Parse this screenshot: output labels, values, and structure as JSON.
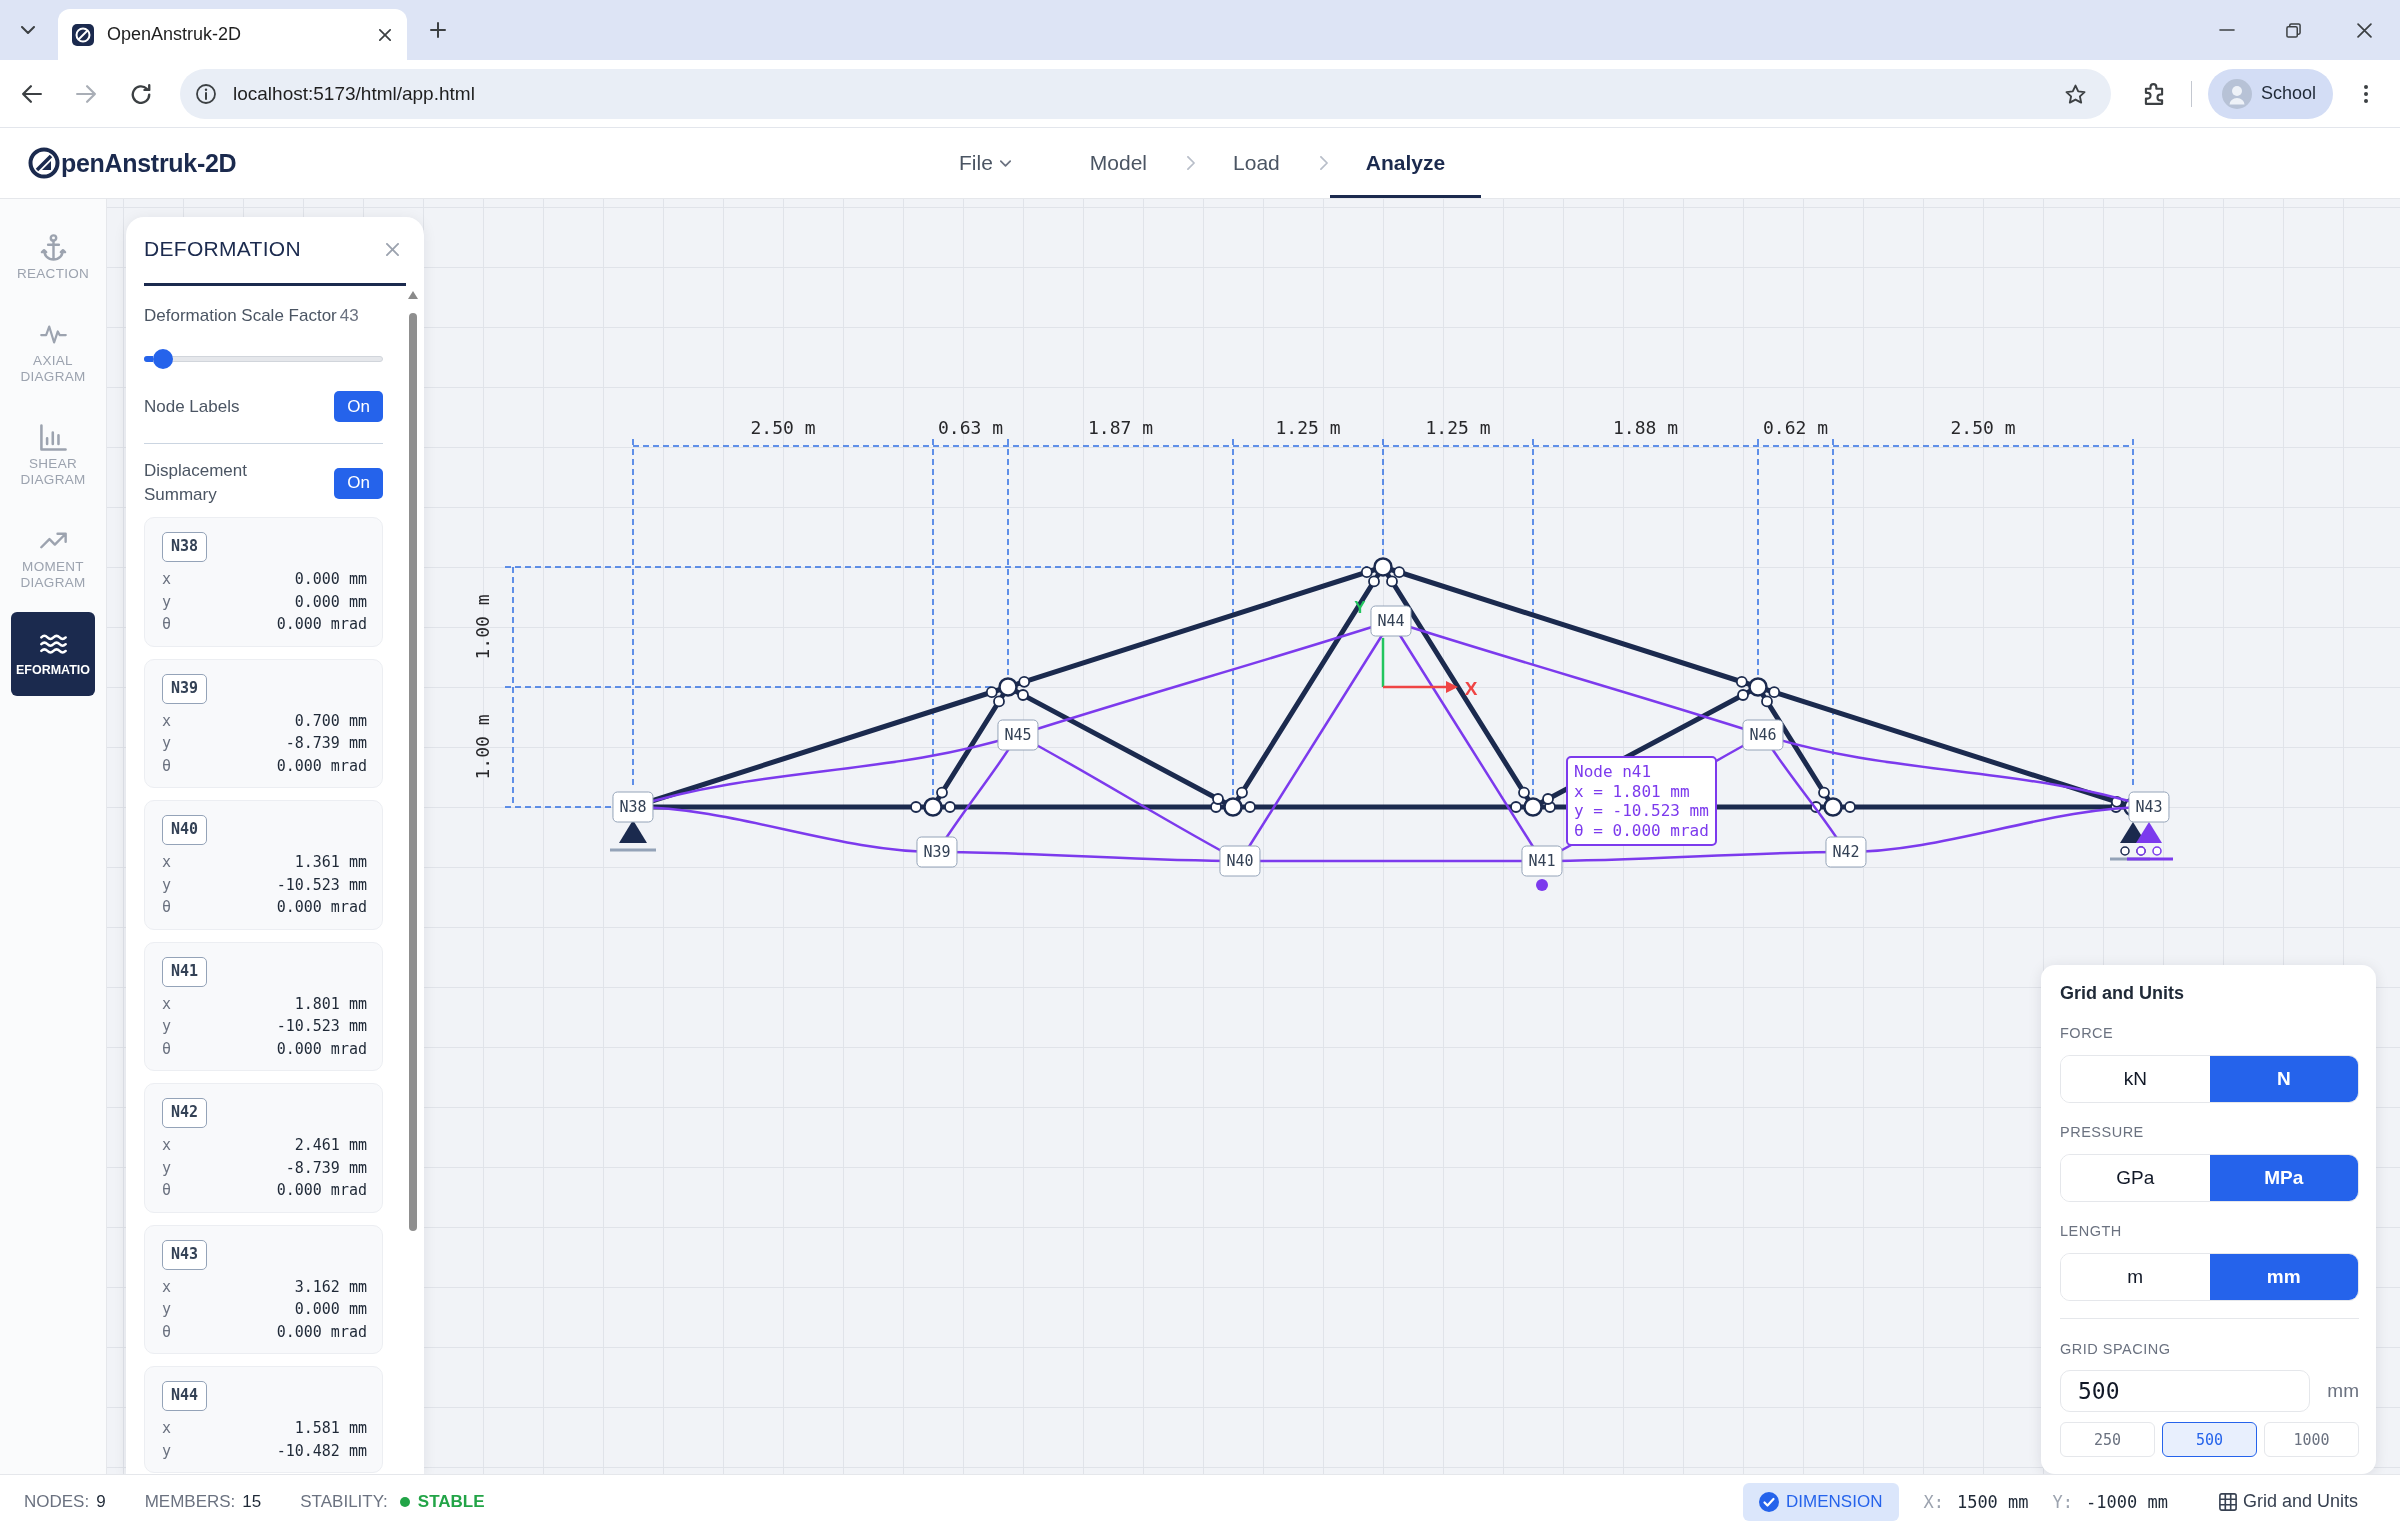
{
  "browser": {
    "tab": {
      "title": "OpenAnstruk-2D"
    },
    "address": "localhost:5173/html/app.html",
    "forward": {
      "disabled": true
    },
    "profile": "School"
  },
  "app_header": {
    "logo": "penAnstruk-2D",
    "nav": [
      {
        "label": "File",
        "kind": "menu",
        "selected": false
      },
      {
        "label": "Model",
        "kind": "step",
        "selected": false
      },
      {
        "label": "Load",
        "kind": "step",
        "selected": false
      },
      {
        "label": "Analyze",
        "kind": "step",
        "selected": true
      }
    ]
  },
  "sidebar": {
    "items": [
      {
        "label": "REACTION",
        "selected": false
      },
      {
        "label": "AXIAL DIAGRAM",
        "selected": false
      },
      {
        "label": "SHEAR DIAGRAM",
        "selected": false
      },
      {
        "label": "MOMENT DIAGRAM",
        "selected": false
      },
      {
        "label": "EFORMATIO",
        "selected": true
      }
    ]
  },
  "deformation_panel": {
    "title": "DEFORMATION",
    "scale_factor": {
      "label": "Deformation Scale Factor",
      "value": "43",
      "level": 0.04
    },
    "node_labels": {
      "label": "Node Labels",
      "toggle": "On",
      "on": true
    },
    "displacement_summary": {
      "label": "Displacement Summary",
      "toggle": "On",
      "on": true
    },
    "nodes": [
      {
        "name": "N38",
        "rows": [
          {
            "axis": "x",
            "value": "0.000 mm"
          },
          {
            "axis": "y",
            "value": "0.000 mm"
          },
          {
            "axis": "θ",
            "value": "0.000 mrad"
          }
        ]
      },
      {
        "name": "N39",
        "rows": [
          {
            "axis": "x",
            "value": "0.700 mm"
          },
          {
            "axis": "y",
            "value": "-8.739 mm"
          },
          {
            "axis": "θ",
            "value": "0.000 mrad"
          }
        ]
      },
      {
        "name": "N40",
        "rows": [
          {
            "axis": "x",
            "value": "1.361 mm"
          },
          {
            "axis": "y",
            "value": "-10.523 mm"
          },
          {
            "axis": "θ",
            "value": "0.000 mrad"
          }
        ]
      },
      {
        "name": "N41",
        "rows": [
          {
            "axis": "x",
            "value": "1.801 mm"
          },
          {
            "axis": "y",
            "value": "-10.523 mm"
          },
          {
            "axis": "θ",
            "value": "0.000 mrad"
          }
        ]
      },
      {
        "name": "N42",
        "rows": [
          {
            "axis": "x",
            "value": "2.461 mm"
          },
          {
            "axis": "y",
            "value": "-8.739 mm"
          },
          {
            "axis": "θ",
            "value": "0.000 mrad"
          }
        ]
      },
      {
        "name": "N43",
        "rows": [
          {
            "axis": "x",
            "value": "3.162 mm"
          },
          {
            "axis": "y",
            "value": "0.000 mm"
          },
          {
            "axis": "θ",
            "value": "0.000 mrad"
          }
        ]
      },
      {
        "name": "N44",
        "rows": [
          {
            "axis": "x",
            "value": "1.581 mm"
          },
          {
            "axis": "y",
            "value": "-10.482 mm"
          }
        ]
      }
    ]
  },
  "canvas": {
    "dimensions": {
      "horizontal": [
        "2.50 m",
        "0.63 m",
        "1.87 m",
        "1.25 m",
        "1.25 m",
        "1.88 m",
        "0.62 m",
        "2.50 m"
      ],
      "vertical": [
        "1.00 m",
        "1.00 m"
      ]
    },
    "axes": {
      "x": "X",
      "y": "Y"
    },
    "node_labels": [
      {
        "label": "N38",
        "hovered": false
      },
      {
        "label": "N39",
        "hovered": false
      },
      {
        "label": "N40",
        "hovered": false
      },
      {
        "label": "N41",
        "hovered": true
      },
      {
        "label": "N42",
        "hovered": false
      },
      {
        "label": "N43",
        "hovered": false
      },
      {
        "label": "N44",
        "hovered": false
      },
      {
        "label": "N45",
        "hovered": false
      },
      {
        "label": "N46",
        "hovered": false
      }
    ],
    "tooltip": [
      "Node n41",
      "x = 1.801 mm",
      "y = -10.523 mm",
      "θ = 0.000 mrad"
    ]
  },
  "grid_units": {
    "title": "Grid and Units",
    "groups": [
      {
        "label": "FORCE",
        "options": [
          {
            "label": "kN",
            "selected": false
          },
          {
            "label": "N",
            "selected": true
          }
        ]
      },
      {
        "label": "PRESSURE",
        "options": [
          {
            "label": "GPa",
            "selected": false
          },
          {
            "label": "MPa",
            "selected": true
          }
        ]
      },
      {
        "label": "LENGTH",
        "options": [
          {
            "label": "m",
            "selected": false
          },
          {
            "label": "mm",
            "selected": true
          }
        ]
      }
    ],
    "grid_spacing": {
      "label": "GRID SPACING",
      "value": "500",
      "unit": "mm",
      "presets": [
        {
          "label": "250",
          "selected": false
        },
        {
          "label": "500",
          "selected": true
        },
        {
          "label": "1000",
          "selected": false
        }
      ]
    }
  },
  "status_bar": {
    "counts": [
      {
        "label": "NODES:",
        "value": "9"
      },
      {
        "label": "MEMBERS:",
        "value": "15"
      }
    ],
    "stability": {
      "label": "STABILITY:",
      "value": "STABLE",
      "kind": "stable"
    },
    "dimension": {
      "label": "DIMENSION",
      "checked": true
    },
    "cursor": [
      {
        "label": "X:",
        "value": "1500 mm"
      },
      {
        "label": "Y:",
        "value": "-1000 mm"
      }
    ],
    "grid_button": "Grid and Units"
  }
}
